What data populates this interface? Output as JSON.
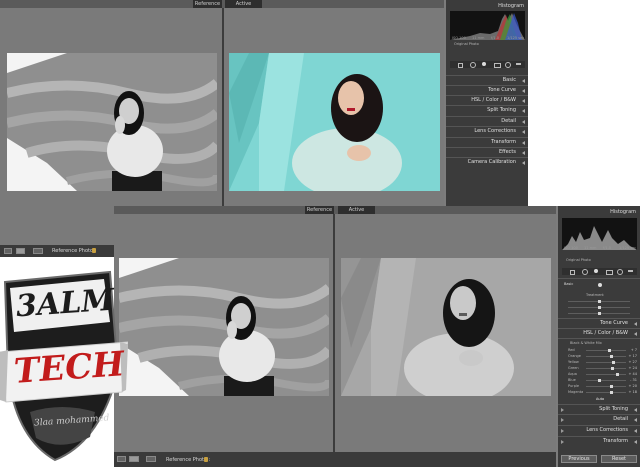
{
  "window_top": {
    "tabs": {
      "reference": "Reference",
      "active": "Active"
    },
    "toolbar": {
      "reference_photo_label": "Reference Photo :"
    },
    "panel": {
      "histogram_title": "Histogram",
      "hist_readout": [
        "ISO 100",
        "11 mm",
        "f/1.0",
        "1/125 sec"
      ],
      "original_photo": "Original Photo",
      "sections": [
        "Basic",
        "Tone Curve",
        "HSL / Color / B&W",
        "Split Toning",
        "Detail",
        "Lens Corrections",
        "Transform",
        "Effects",
        "Camera Calibration"
      ]
    }
  },
  "window_bottom": {
    "tabs": {
      "reference": "Reference",
      "active": "Active"
    },
    "toolbar": {
      "reference_photo_label": "Reference Photo :"
    },
    "panel": {
      "histogram_title": "Histogram",
      "hist_readout": [
        "ISO 100",
        "11 mm",
        "f/1.0",
        "1/125 sec"
      ],
      "original_photo": "Original Photo",
      "basic_label": "Basic",
      "treatment_label": "Treatment",
      "tone_curve": "Tone Curve",
      "hsl_label": "HSL / Color / B&W",
      "bw_mix_label": "Black & White Mix",
      "auto_label": "Auto",
      "mix": [
        {
          "name": "Red",
          "value": "+ 7"
        },
        {
          "name": "Orange",
          "value": "+ 17"
        },
        {
          "name": "Yellow",
          "value": "+ 27"
        },
        {
          "name": "Green",
          "value": "+ 24"
        },
        {
          "name": "Aqua",
          "value": "+ 44"
        },
        {
          "name": "Blue",
          "value": "- 31"
        },
        {
          "name": "Purple",
          "value": "+ 20"
        },
        {
          "name": "Magenta",
          "value": "+ 18"
        }
      ],
      "lower_sections": [
        "Split Toning",
        "Detail",
        "Lens Corrections",
        "Transform"
      ],
      "previous": "Previous",
      "reset": "Reset"
    }
  },
  "logo": {
    "line1": "3ALM",
    "line2": "TECH",
    "signature": "3laa mohammed"
  },
  "colors": {
    "accent_red": "#c21c1c",
    "teal_bg": "#7fd6d3",
    "panel_bg": "#3b3b3b"
  }
}
